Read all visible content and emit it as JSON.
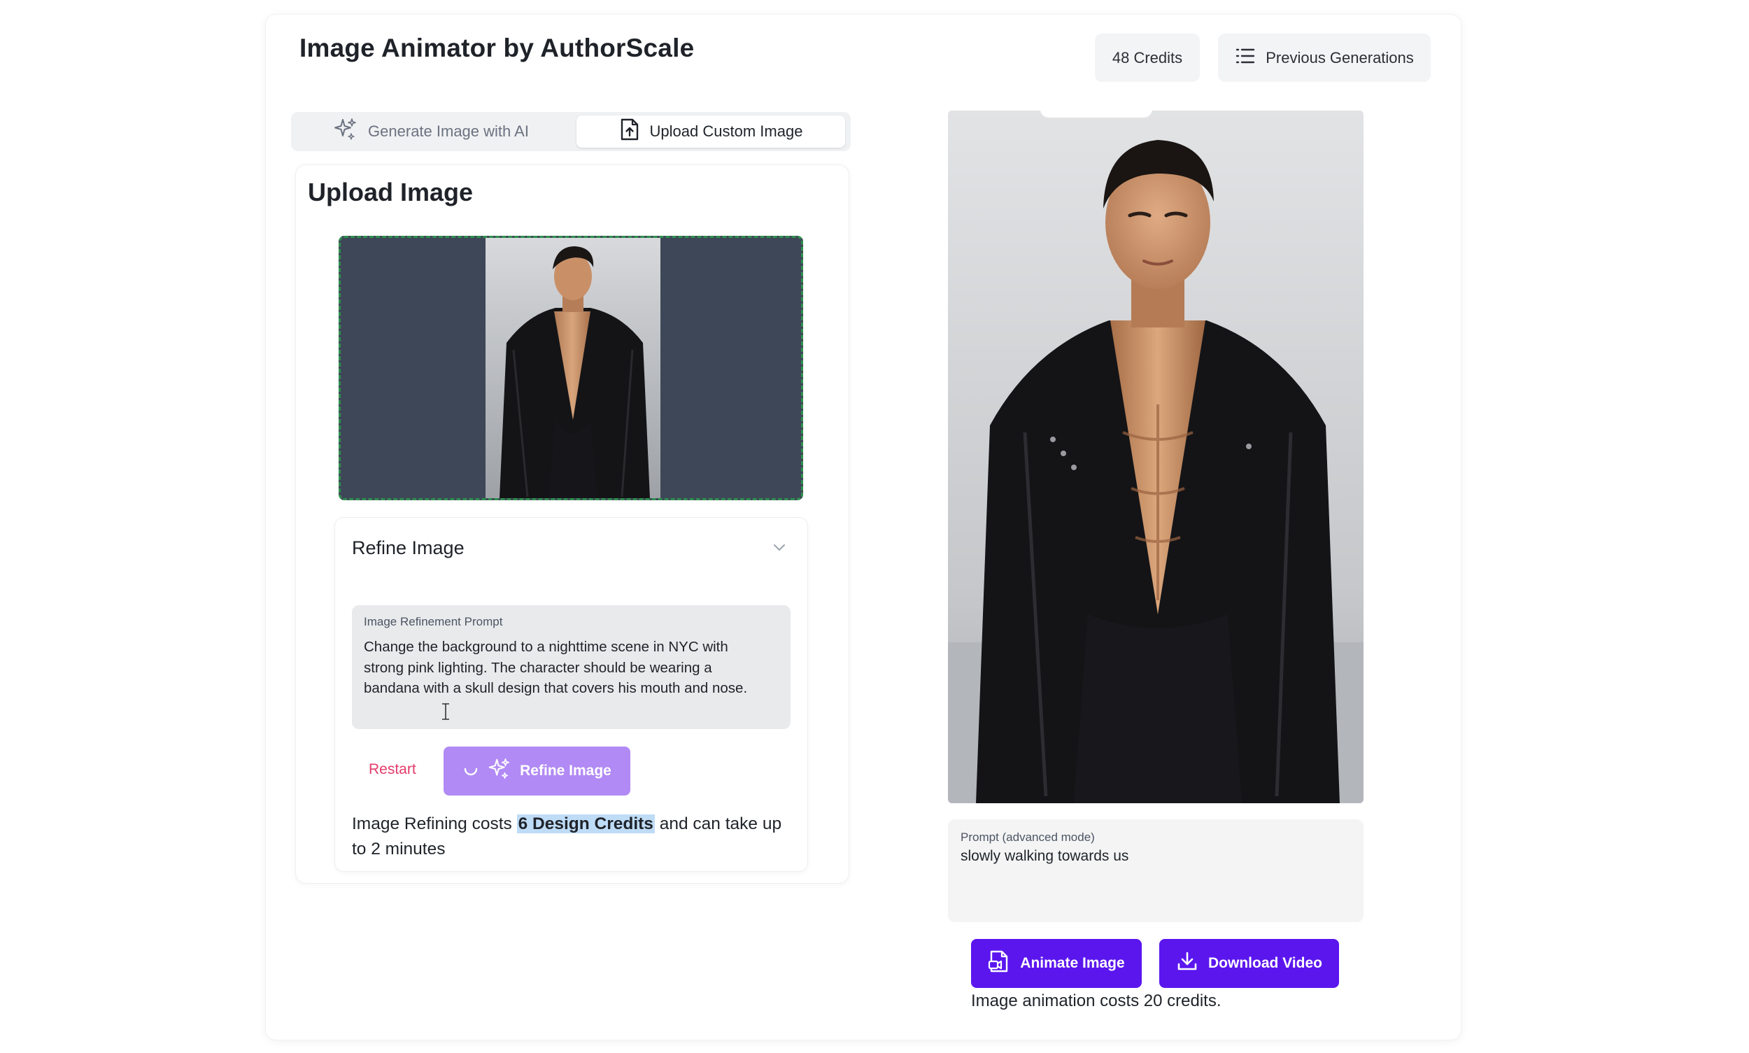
{
  "app": {
    "title": "Image Animator by AuthorScale"
  },
  "header": {
    "credits_label": "48 Credits",
    "previous_generations_label": "Previous Generations"
  },
  "tabs": [
    {
      "label": "Generate Image with AI",
      "active": false,
      "icon": "sparkle-icon"
    },
    {
      "label": "Upload Custom Image",
      "active": true,
      "icon": "file-upload-icon"
    }
  ],
  "upload": {
    "title": "Upload Image",
    "image_alt": "uploaded portrait"
  },
  "refine": {
    "title": "Refine Image",
    "prompt_label": "Image Refinement Prompt",
    "prompt_value": "Change the background to a nighttime scene in NYC with strong pink lighting. The character should be wearing a bandana with a skull design that covers his mouth and nose.",
    "restart_label": "Restart",
    "refine_button_label": "Refine Image",
    "cost_prefix": "Image Refining costs ",
    "cost_highlight": "6 Design Credits",
    "cost_suffix": " and can take up to 2 minutes"
  },
  "preview": {
    "advanced_prompt_label": "Prompt (advanced mode)",
    "advanced_prompt_value": "slowly walking towards us"
  },
  "actions": {
    "animate_label": "Animate Image",
    "download_label": "Download Video",
    "animation_cost_note": "Image animation costs 20 credits."
  },
  "colors": {
    "accent_purple": "#5b16ee",
    "refine_button_purple": "#b18af5",
    "restart_pink": "#e23c6b",
    "dropzone_bg": "#3e4757",
    "dropzone_border": "#2f8f4f",
    "highlight_blue": "#bfdcf7"
  }
}
